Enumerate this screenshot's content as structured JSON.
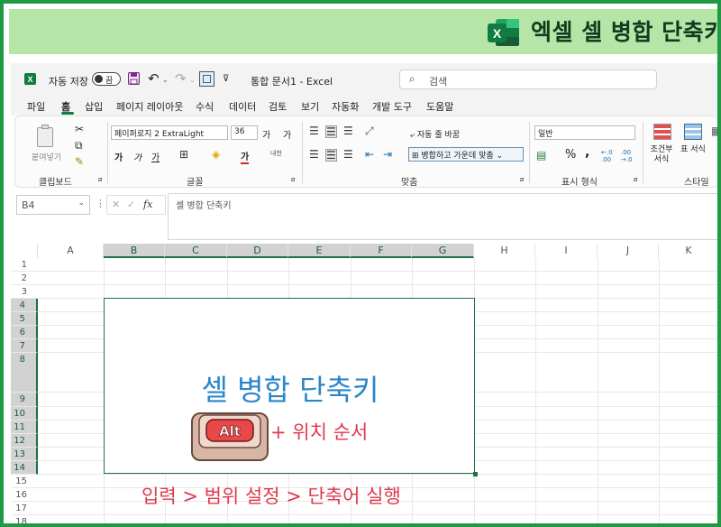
{
  "banner": {
    "title": "엑셀 셀 병합 단축키",
    "logo_letter": "X"
  },
  "titlebar": {
    "autosave_label": "자동 저장",
    "autosave_toggle": "끔",
    "doc_title": "통합 문서1  -  Excel",
    "search_placeholder": "검색"
  },
  "menu": [
    {
      "label": "파일"
    },
    {
      "label": "홈"
    },
    {
      "label": "삽입"
    },
    {
      "label": "페이지 레이아웃"
    },
    {
      "label": "수식"
    },
    {
      "label": "데이터"
    },
    {
      "label": "검토"
    },
    {
      "label": "보기"
    },
    {
      "label": "자동화"
    },
    {
      "label": "개발 도구"
    },
    {
      "label": "도움말"
    }
  ],
  "ribbon": {
    "clipboard": {
      "paste_label": "붙여넣기",
      "group_label": "클립보드"
    },
    "font": {
      "font_name": "페이퍼로지 2 ExtraLight",
      "font_size": "36",
      "grow": "가",
      "shrink": "가",
      "bold": "가",
      "italic": "가",
      "underline": "가",
      "font_color_char": "가",
      "phonetic": "내천",
      "group_label": "글꼴"
    },
    "alignment": {
      "wrap_text": "자동 줄 바꿈",
      "merge_center": "병합하고 가운데 맞춤",
      "group_label": "맞춤"
    },
    "number": {
      "format": "일반",
      "percent": "%",
      "comma": ",",
      "group_label": "표시 형식"
    },
    "styles": {
      "conditional": "조건부 서식",
      "table": "표 서식",
      "group_label": "스타일"
    }
  },
  "formula_bar": {
    "name_box": "B4",
    "fx": "fx",
    "content": "셀 병합 단축키"
  },
  "sheet": {
    "columns": [
      "A",
      "B",
      "C",
      "D",
      "E",
      "F",
      "G",
      "H",
      "I",
      "J",
      "K"
    ],
    "rows": [
      "1",
      "2",
      "3",
      "4",
      "5",
      "6",
      "7",
      "8",
      "9",
      "10",
      "11",
      "12",
      "13",
      "14",
      "15",
      "16",
      "17",
      "18"
    ],
    "merged_text": "셀 병합 단축키",
    "alt_key_label": "Alt",
    "shortcut_text": "+ 위치 순서",
    "caption": "입력 > 범위 설정 > 단축어 실행"
  },
  "colors": {
    "excel_green": "#107c41",
    "banner_bg": "#b5e6a8",
    "title_blue": "#2a86c9",
    "accent_red": "#e0384c"
  }
}
